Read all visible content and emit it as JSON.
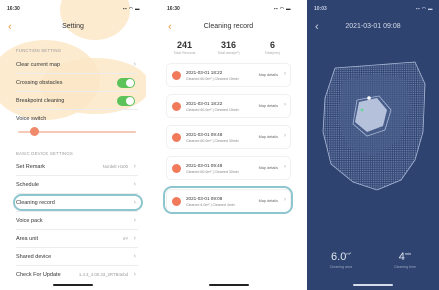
{
  "screen1": {
    "status_time": "16:30",
    "status_icons": "▪▪ ◠ ▬",
    "title": "Setting",
    "back": "‹",
    "function_section": "FUNCTION SETTING",
    "items_a": [
      {
        "label": "Clear current map",
        "type": "chevron"
      },
      {
        "label": "Crossing obstacles",
        "type": "toggle",
        "on": true
      },
      {
        "label": "Breakpoint cleaning",
        "type": "toggle",
        "on": true
      }
    ],
    "voice_label": "Voice switch",
    "basic_section": "BASIC DEVICE SETTINGS",
    "items_b": [
      {
        "label": "Set Remark",
        "value": "Nordelt H100"
      },
      {
        "label": "Schedule",
        "value": ""
      },
      {
        "label": "Cleaning record",
        "value": ""
      },
      {
        "label": "Voice pack",
        "value": ""
      },
      {
        "label": "Area unit",
        "value": "m²"
      },
      {
        "label": "Shared device",
        "value": ""
      },
      {
        "label": "Check For Update",
        "value": "1.4.3_4.00.33_2RTB4ebd"
      }
    ],
    "chevron": "›"
  },
  "screen2": {
    "status_time": "16:30",
    "status_icons": "▪▪ ◠ ▬",
    "title": "Cleaning record",
    "back": "‹",
    "stats": [
      {
        "value": "241",
        "label": "Total Records"
      },
      {
        "value": "316",
        "label": "Total area(m²)"
      },
      {
        "value": "6",
        "label": "Total(min)"
      }
    ],
    "records": [
      {
        "date": "2021-03-01 18:22",
        "info": "Cleaned 60.0m² | Cleaned 15min",
        "map": "Map details"
      },
      {
        "date": "2021-03-01 18:22",
        "info": "Cleaned 60.0m² | Cleaned 15min",
        "map": "Map details"
      },
      {
        "date": "2021-03-01 09:48",
        "info": "Cleaned 60.0m² | Cleaned 30min",
        "map": "Map details"
      },
      {
        "date": "2021-03-01 09:48",
        "info": "Cleaned 60.0m² | Cleaned 30min",
        "map": "Map details"
      },
      {
        "date": "2021-03-01 09:15",
        "info": "Cleaned 15.0m² | Cleaned 25min",
        "map": "Map details"
      },
      {
        "date": "2021-03-01 09:08",
        "info": "Cleaned 6.0m² | Cleaned 4min",
        "map": "Map details"
      }
    ],
    "chevron": "›"
  },
  "screen3": {
    "status_time": "10:03",
    "status_icons": "▪▪ ◠ ▬",
    "back": "‹",
    "title": "2021-03-01 09:08",
    "area_value": "6.0",
    "area_unit": "m²",
    "area_label": "Cleaning area",
    "time_value": "4",
    "time_unit": "min",
    "time_label": "Cleaning time"
  },
  "colors": {
    "accent_orange": "#f0a040",
    "toggle_green": "#5cc25a",
    "record_dot": "#f07a5a",
    "highlight": "#8ec6cf",
    "map_bg": "#2f4370"
  }
}
